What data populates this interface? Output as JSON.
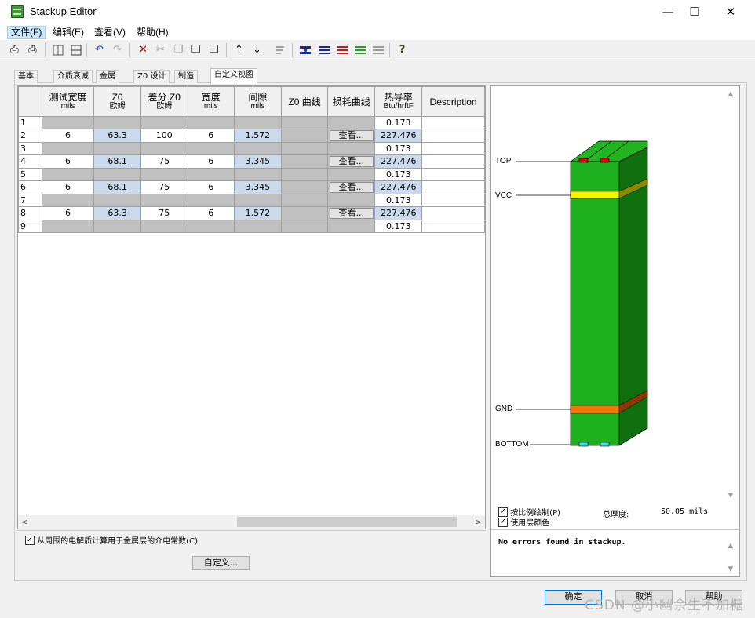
{
  "window": {
    "title": "Stackup Editor",
    "minimize": "—",
    "maximize": "☐",
    "close": "✕"
  },
  "menu": [
    {
      "label": "文件(F)",
      "name": "menu-file"
    },
    {
      "label": "编辑(E)",
      "name": "menu-edit"
    },
    {
      "label": "查看(V)",
      "name": "menu-view"
    },
    {
      "label": "帮助(H)",
      "name": "menu-help"
    }
  ],
  "toolbar": {
    "print_glyph": "⎙",
    "print_preview_glyph": "⎙",
    "undo_glyph": "↶",
    "redo_glyph": "↷",
    "delete_glyph": "✕",
    "cut_glyph": "✂",
    "copy_glyph": "❐",
    "paste_glyph": "❏",
    "insert_above_glyph": "⇡",
    "insert_below_glyph": "⇣",
    "help_glyph": "?"
  },
  "tabs": [
    "基本",
    "介质衰减",
    "金属",
    "Z0 设计",
    "制造",
    "自定义视图"
  ],
  "grid": {
    "columns": [
      {
        "title": "测试宽度",
        "sub": "mils"
      },
      {
        "title": "Z0",
        "sub": "欧姆"
      },
      {
        "title": "差分 Z0",
        "sub": "欧姆"
      },
      {
        "title": "宽度",
        "sub": "mils"
      },
      {
        "title": "间隙",
        "sub": "mils"
      },
      {
        "title": "Z0 曲线",
        "sub": ""
      },
      {
        "title": "损耗曲线",
        "sub": ""
      },
      {
        "title": "热导率",
        "sub": "Btu/hrftF"
      },
      {
        "title": "Description",
        "sub": ""
      }
    ],
    "view_button": "查看...",
    "rows": [
      {
        "n": "1",
        "test_width": "",
        "z0": "",
        "diff_z0": "",
        "width": "",
        "gap": "",
        "thermal": "0.173",
        "signal": false
      },
      {
        "n": "2",
        "test_width": "6",
        "z0": "63.3",
        "diff_z0": "100",
        "width": "6",
        "gap": "1.572",
        "thermal": "227.476",
        "signal": true
      },
      {
        "n": "3",
        "test_width": "",
        "z0": "",
        "diff_z0": "",
        "width": "",
        "gap": "",
        "thermal": "0.173",
        "signal": false
      },
      {
        "n": "4",
        "test_width": "6",
        "z0": "68.1",
        "diff_z0": "75",
        "width": "6",
        "gap": "3.345",
        "thermal": "227.476",
        "signal": true
      },
      {
        "n": "5",
        "test_width": "",
        "z0": "",
        "diff_z0": "",
        "width": "",
        "gap": "",
        "thermal": "0.173",
        "signal": false
      },
      {
        "n": "6",
        "test_width": "6",
        "z0": "68.1",
        "diff_z0": "75",
        "width": "6",
        "gap": "3.345",
        "thermal": "227.476",
        "signal": true
      },
      {
        "n": "7",
        "test_width": "",
        "z0": "",
        "diff_z0": "",
        "width": "",
        "gap": "",
        "thermal": "0.173",
        "signal": false
      },
      {
        "n": "8",
        "test_width": "6",
        "z0": "63.3",
        "diff_z0": "75",
        "width": "6",
        "gap": "1.572",
        "thermal": "227.476",
        "signal": true
      },
      {
        "n": "9",
        "test_width": "",
        "z0": "",
        "diff_z0": "",
        "width": "",
        "gap": "",
        "thermal": "0.173",
        "signal": false
      }
    ]
  },
  "scroll": {
    "left": "<",
    "right": ">",
    "up": "▲",
    "down": "▼"
  },
  "options": {
    "compute_dielectric": "从周围的电解质计算用于金属层的介电常数(C)",
    "compute_dielectric_checked": "✓",
    "custom_button": "自定义..."
  },
  "preview": {
    "layers": [
      {
        "name": "TOP"
      },
      {
        "name": "VCC"
      },
      {
        "name": "GND"
      },
      {
        "name": "BOTTOM"
      }
    ],
    "colors": {
      "board": "#1fb01f",
      "board_dark": "#107010",
      "vcc": "#f4f400",
      "gnd": "#f07800",
      "pad_top": "#e00000",
      "pad_bottom": "#40e0e0"
    },
    "scale_draw": "按比例绘制(P)",
    "use_layer_colors": "使用层颜色",
    "checked": "✓",
    "total_thickness_label": "总厚度:",
    "total_thickness_value": "50.05 mils",
    "status": "No errors found in stackup."
  },
  "footer": {
    "ok": "确定",
    "cancel": "取消",
    "help": "帮助"
  },
  "watermark": "CSDN @小幽余生不加糖"
}
